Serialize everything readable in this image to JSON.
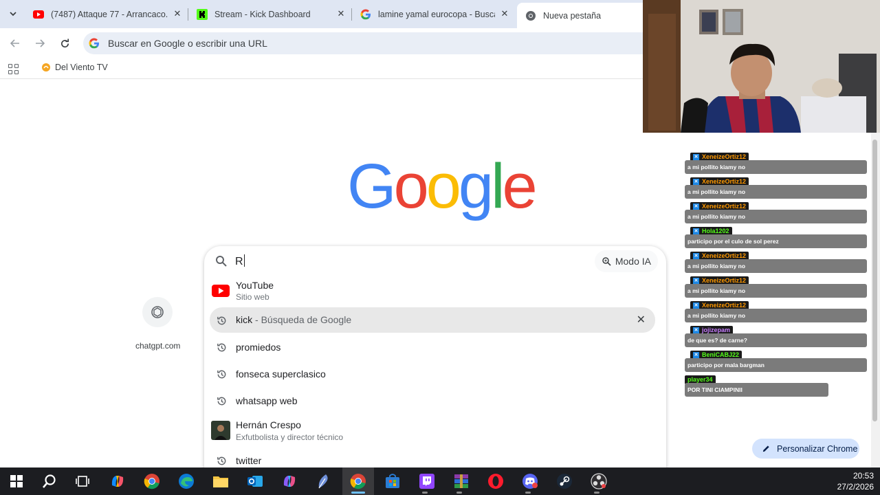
{
  "tabs": [
    {
      "title": "(7487) Attaque 77 - Arrancaco...",
      "icon": "youtube-icon"
    },
    {
      "title": "Stream - Kick Dashboard",
      "icon": "kick-icon"
    },
    {
      "title": "lamine yamal eurocopa - Busca...",
      "icon": "google-icon"
    },
    {
      "title": "Nueva pestaña",
      "icon": "chrome-icon"
    }
  ],
  "omnibox": {
    "placeholder": "Buscar en Google o escribir una URL"
  },
  "bookmarks": [
    {
      "label": "Del Viento TV"
    }
  ],
  "google_logo": [
    "G",
    "o",
    "o",
    "g",
    "l",
    "e"
  ],
  "shortcuts": [
    {
      "label": "chatgpt.com"
    }
  ],
  "search": {
    "query": "R",
    "ai_mode_label": "Modo IA",
    "suggestions": [
      {
        "title": "YouTube",
        "subtitle": "Sitio web",
        "icon": "youtube-icon"
      },
      {
        "title": "kick",
        "suffix": " - Búsqueda de Google",
        "icon": "history-icon",
        "highlighted": true
      },
      {
        "title": "promiedos",
        "icon": "history-icon"
      },
      {
        "title": "fonseca superclasico",
        "icon": "history-icon"
      },
      {
        "title": "whatsapp web",
        "icon": "history-icon"
      },
      {
        "title": "Hernán Crespo",
        "subtitle": "Exfutbolista y director técnico",
        "icon": "avatar"
      },
      {
        "title": "twitter",
        "icon": "history-icon"
      }
    ]
  },
  "customize_label": "Personalizar Chrome",
  "chat": [
    {
      "user": "XeneizeOrtiz12",
      "user_color": "#ff9800",
      "text": "a mi pollito kiamy no"
    },
    {
      "user": "XeneizeOrtiz12",
      "user_color": "#ff9800",
      "text": "a mi pollito kiamy no"
    },
    {
      "user": "XeneizeOrtiz12",
      "user_color": "#ff9800",
      "text": "a mi pollito kiamy no"
    },
    {
      "user": "Hola1202",
      "user_color": "#53fc18",
      "text": "participo por el culo de sol perez"
    },
    {
      "user": "XeneizeOrtiz12",
      "user_color": "#ff9800",
      "text": "a mi pollito kiamy no"
    },
    {
      "user": "XeneizeOrtiz12",
      "user_color": "#ff9800",
      "text": "a mi pollito kiamy no"
    },
    {
      "user": "XeneizeOrtiz12",
      "user_color": "#ff9800",
      "text": "a mi pollito kiamy no"
    },
    {
      "user": "jojizepam",
      "user_color": "#c77dff",
      "text": "de que es? de carne?"
    },
    {
      "user": "BeniCABJ22",
      "user_color": "#53fc18",
      "text": "participo por mala bargman"
    },
    {
      "user": "player34",
      "user_color": "#53fc18",
      "text": "POR TINI CIAMPINII"
    }
  ],
  "clock": {
    "time": "20:53",
    "date": "27/2/2026"
  },
  "taskbar_icons": [
    "windows-start-icon",
    "search-icon",
    "task-view-icon",
    "copilot-icon",
    "chrome-icon",
    "edge-icon",
    "file-explorer-icon",
    "outlook-icon",
    "copilot-m365-icon",
    "feather-icon",
    "chrome-active-icon",
    "store-icon",
    "twitch-icon",
    "winrar-icon",
    "opera-icon",
    "discord-icon",
    "steam-icon",
    "obs-icon"
  ]
}
